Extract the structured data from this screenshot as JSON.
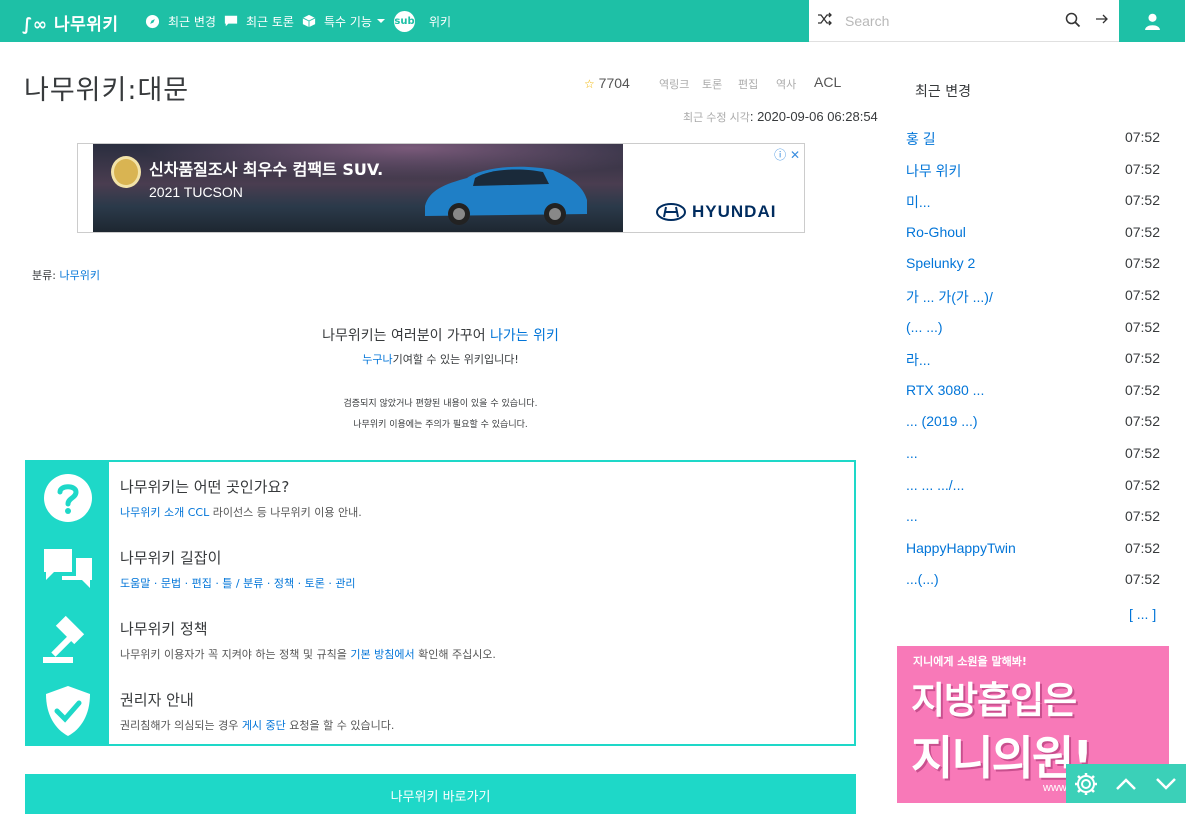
{
  "navbar": {
    "logo": "∫∞ 나무위키",
    "items": [
      {
        "label": "최근 변경",
        "icon": "compass-icon"
      },
      {
        "label": "최근 토론",
        "icon": "comment-icon"
      },
      {
        "label": "특수 기능",
        "icon": "cube-icon"
      },
      {
        "label": "위키",
        "icon": "subwiki-logo-icon"
      }
    ],
    "subwiki_badge": "sub",
    "search_placeholder": "Search",
    "colors": {
      "primary": "#1ec0a6",
      "accent": "#1ed8c8",
      "link": "#0275d8"
    }
  },
  "page": {
    "title": "나무위키:대문",
    "star_count": "7704",
    "toolbar": [
      "역링크",
      "토론",
      "편집",
      "역사"
    ],
    "acl": "ACL",
    "last_modified_label": "최근 수정 시각",
    "last_modified": "2020-09-06 06:28:54"
  },
  "ad": {
    "headline": "신차품질조사 최우수 컴팩트 SUV.",
    "sub": "2021 TUCSON",
    "brand": "HYUNDAI",
    "close": "ⓘ ✕"
  },
  "category": {
    "label": "분류",
    "value": "나무위키"
  },
  "notice": {
    "title_text": "나무위키는 여러분이 가꾸어",
    "title_link": "나가는 위키",
    "sub_link": "누구나",
    "sub_text": "기여할 수 있는 위키입니다!",
    "line1": "검증되지 않았거나 편향된 내용이 있을 수 있습니다.",
    "line2": "나무위키 이용에는 주의가 필요할 수 있습니다."
  },
  "info_box": [
    {
      "icon": "question-icon",
      "title": "나무위키는 어떤 곳인가요?",
      "desc_link": "CCL",
      "desc_pre": "나무위키 소개",
      "desc_post": "라이선스 등 나무위키 이용 안내."
    },
    {
      "icon": "chat-icon",
      "title": "나무위키 길잡이",
      "desc_pre": "도움말 · 문법 · 편집 · 틀 / 분류 · 정책 · 토론 · 관리",
      "desc_link": "",
      "desc_post": ""
    },
    {
      "icon": "gavel-icon",
      "title": "나무위키 정책",
      "desc_pre": "나무위키 이용자가 꼭 지켜야 하는 정책 및 규칙을",
      "desc_link": "기본 방침에서",
      "desc_post": "확인해 주십시오."
    },
    {
      "icon": "shield-check-icon",
      "title": "권리자 안내",
      "desc_pre": "권리침해가 의심되는 경우",
      "desc_link": "게시 중단",
      "desc_post": "요청을 할 수 있습니다."
    }
  ],
  "bottom_button": "나무위키 바로가기",
  "sidebar": {
    "title": "최근 변경",
    "items": [
      {
        "name": "홍 길",
        "time": "07:52"
      },
      {
        "name": "나무 위키",
        "time": "07:52"
      },
      {
        "name": "미...",
        "time": "07:52"
      },
      {
        "name": "Ro-Ghoul",
        "time": "07:52"
      },
      {
        "name": "Spelunky 2",
        "time": "07:52"
      },
      {
        "name": "가 ... 가(가 ...)/",
        "time": "07:52"
      },
      {
        "name": "(... ...)",
        "time": "07:52"
      },
      {
        "name": "라...",
        "time": "07:52"
      },
      {
        "name": "RTX 3080 ...",
        "time": "07:52"
      },
      {
        "name": "... (2019 ...)",
        "time": "07:52"
      },
      {
        "name": "...",
        "time": "07:52"
      },
      {
        "name": "... ... .../...",
        "time": "07:52"
      },
      {
        "name": "...",
        "time": "07:52"
      },
      {
        "name": "HappyHappyTwin",
        "time": "07:52"
      },
      {
        "name": "...(...)",
        "time": "07:52"
      }
    ],
    "more": "[ ... ]"
  },
  "side_ad": {
    "small": "지니에게 소원을 말해봐!",
    "big1": "지방흡입은",
    "big2": "지니의원!",
    "url": "www.jinicli.co.kr"
  }
}
